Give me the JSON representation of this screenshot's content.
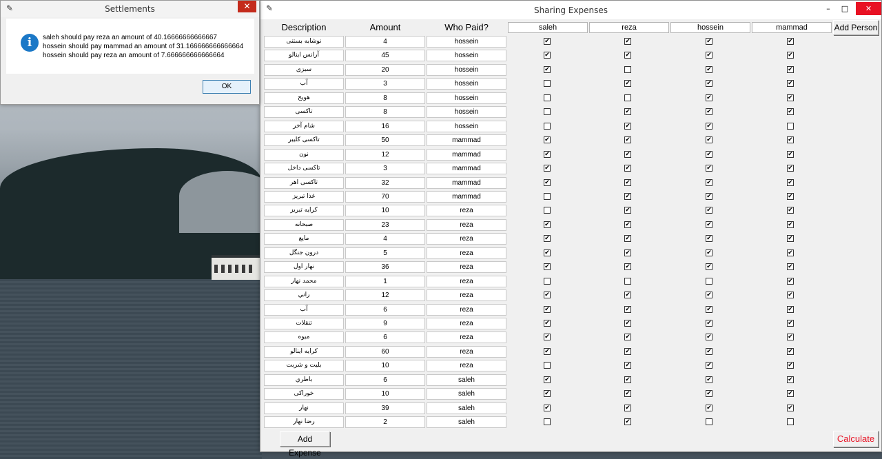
{
  "settlements_dialog": {
    "title": "Settlements",
    "close_glyph": "✕",
    "messages": [
      "saleh should pay reza an amount of 40.16666666666667",
      "hossein should pay mammad an amount of 31.166666666666664",
      "hossein should pay reza an amount of 7.666666666666664"
    ],
    "ok_label": "OK",
    "icon": "info-icon"
  },
  "main_window": {
    "title": "Sharing Expenses",
    "minimize_glyph": "–",
    "maximize_glyph": "□",
    "close_glyph": "✕",
    "headers": {
      "description": "Description",
      "amount": "Amount",
      "who_paid": "Who Paid?"
    },
    "people": [
      "saleh",
      "reza",
      "hossein",
      "mammad"
    ],
    "add_person_label": "Add Person",
    "add_expense_label": "Add Expense",
    "calculate_label": "Calculate",
    "calculate_color": "#e81123",
    "check_glyph": "✔",
    "expenses": [
      {
        "desc": "نوشابه بستنی",
        "amount": "4",
        "payer": "hossein",
        "checks": [
          true,
          true,
          true,
          true
        ]
      },
      {
        "desc": "آرانس اينالو",
        "amount": "45",
        "payer": "hossein",
        "checks": [
          true,
          true,
          true,
          true
        ]
      },
      {
        "desc": "سبزی",
        "amount": "20",
        "payer": "hossein",
        "checks": [
          true,
          false,
          true,
          true
        ]
      },
      {
        "desc": "آب",
        "amount": "3",
        "payer": "hossein",
        "checks": [
          false,
          true,
          true,
          true
        ]
      },
      {
        "desc": "هويج",
        "amount": "8",
        "payer": "hossein",
        "checks": [
          false,
          false,
          true,
          true
        ]
      },
      {
        "desc": "تاکسی",
        "amount": "8",
        "payer": "hossein",
        "checks": [
          false,
          true,
          true,
          true
        ]
      },
      {
        "desc": "شام آخر",
        "amount": "16",
        "payer": "hossein",
        "checks": [
          false,
          true,
          true,
          false
        ]
      },
      {
        "desc": "تاکسی کليبر",
        "amount": "50",
        "payer": "mammad",
        "checks": [
          true,
          true,
          true,
          true
        ]
      },
      {
        "desc": "نون",
        "amount": "12",
        "payer": "mammad",
        "checks": [
          true,
          true,
          true,
          true
        ]
      },
      {
        "desc": "تاکسی داخل",
        "amount": "3",
        "payer": "mammad",
        "checks": [
          true,
          true,
          true,
          true
        ]
      },
      {
        "desc": "تاکسی اهر",
        "amount": "32",
        "payer": "mammad",
        "checks": [
          true,
          true,
          true,
          true
        ]
      },
      {
        "desc": "غذا تبريز",
        "amount": "70",
        "payer": "mammad",
        "checks": [
          false,
          true,
          true,
          true
        ]
      },
      {
        "desc": "کرايه تبريز",
        "amount": "10",
        "payer": "reza",
        "checks": [
          false,
          true,
          true,
          true
        ]
      },
      {
        "desc": "صبحانه",
        "amount": "23",
        "payer": "reza",
        "checks": [
          true,
          true,
          true,
          true
        ]
      },
      {
        "desc": "مايع",
        "amount": "4",
        "payer": "reza",
        "checks": [
          true,
          true,
          true,
          true
        ]
      },
      {
        "desc": "درون جنگل",
        "amount": "5",
        "payer": "reza",
        "checks": [
          true,
          true,
          true,
          true
        ]
      },
      {
        "desc": "نهار اول",
        "amount": "36",
        "payer": "reza",
        "checks": [
          true,
          true,
          true,
          true
        ]
      },
      {
        "desc": "محمد نهار",
        "amount": "1",
        "payer": "reza",
        "checks": [
          false,
          false,
          false,
          true
        ]
      },
      {
        "desc": "راني",
        "amount": "12",
        "payer": "reza",
        "checks": [
          true,
          true,
          true,
          true
        ]
      },
      {
        "desc": "آب",
        "amount": "6",
        "payer": "reza",
        "checks": [
          true,
          true,
          true,
          true
        ]
      },
      {
        "desc": "تنقلات",
        "amount": "9",
        "payer": "reza",
        "checks": [
          true,
          true,
          true,
          true
        ]
      },
      {
        "desc": "ميوه",
        "amount": "6",
        "payer": "reza",
        "checks": [
          true,
          true,
          true,
          true
        ]
      },
      {
        "desc": "کرايه اينالو",
        "amount": "60",
        "payer": "reza",
        "checks": [
          true,
          true,
          true,
          true
        ]
      },
      {
        "desc": "بليت و شربت",
        "amount": "10",
        "payer": "reza",
        "checks": [
          false,
          true,
          true,
          true
        ]
      },
      {
        "desc": "باطري",
        "amount": "6",
        "payer": "saleh",
        "checks": [
          true,
          true,
          true,
          true
        ]
      },
      {
        "desc": "خوراکی",
        "amount": "10",
        "payer": "saleh",
        "checks": [
          true,
          true,
          true,
          true
        ]
      },
      {
        "desc": "نهار",
        "amount": "39",
        "payer": "saleh",
        "checks": [
          true,
          true,
          true,
          true
        ]
      },
      {
        "desc": "رضا نهار",
        "amount": "2",
        "payer": "saleh",
        "checks": [
          false,
          true,
          false,
          false
        ]
      }
    ]
  }
}
